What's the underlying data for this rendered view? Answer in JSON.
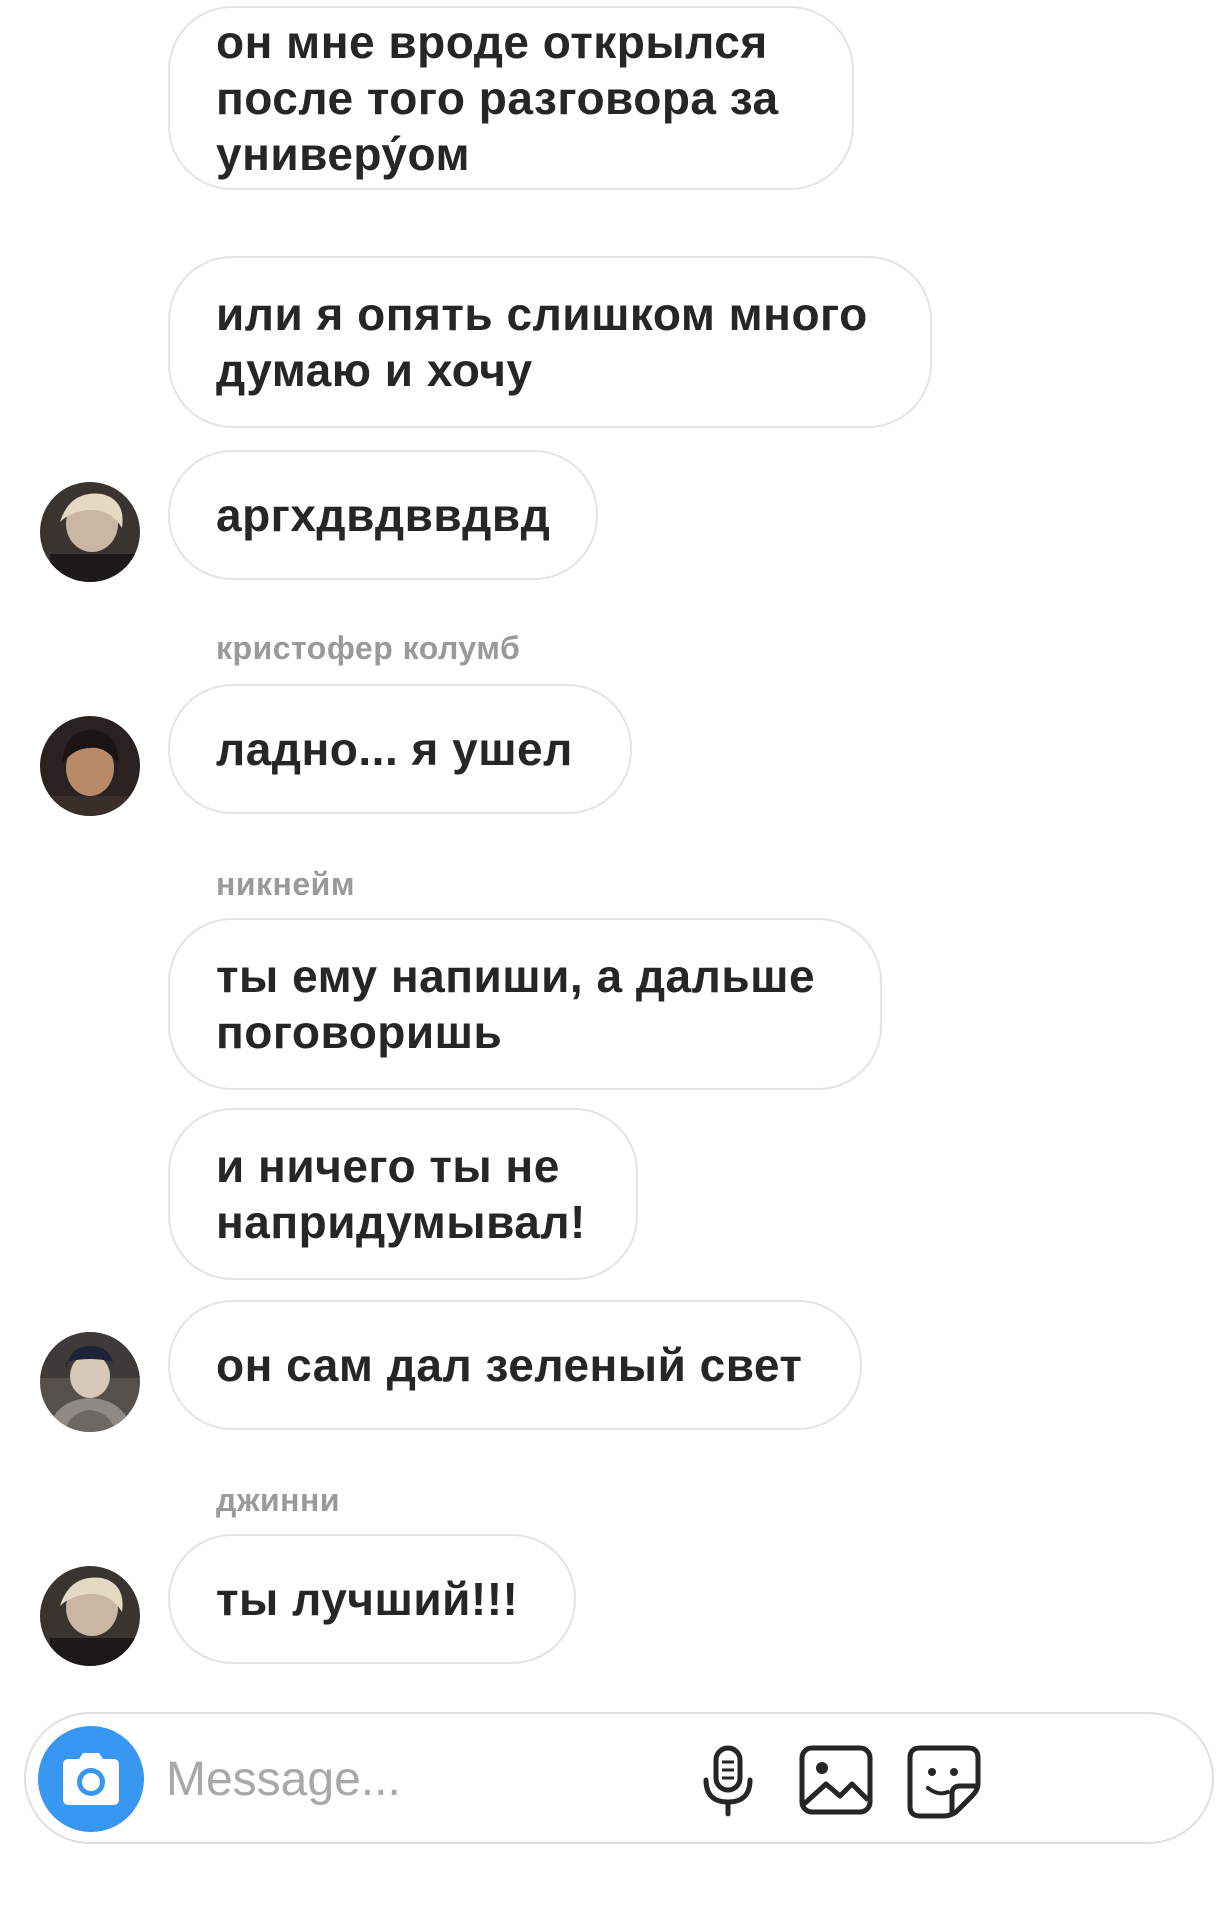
{
  "messages": [
    {
      "text": "он мне вроде открылся\nпосле того разговора за\nуниверу́ом"
    },
    {
      "text": "или я опять слишком много\nдумаю и хочу"
    },
    {
      "text": "аргхдвдввдвд"
    },
    {
      "sender": "кристофер колумб"
    },
    {
      "text": "ладно... я ушел"
    },
    {
      "sender": "никнейм"
    },
    {
      "text": "ты ему напиши, а дальше\nпоговоришь"
    },
    {
      "text": "и ничего ты не\nнапридумывал!"
    },
    {
      "text": "он сам дал зеленый свет"
    },
    {
      "sender": "джинни"
    },
    {
      "text": "ты лучший!!!"
    }
  ],
  "composer": {
    "placeholder": "Message...",
    "icons": [
      "camera-icon",
      "microphone-icon",
      "gallery-icon",
      "sticker-icon"
    ],
    "accent": "#3897f0"
  }
}
